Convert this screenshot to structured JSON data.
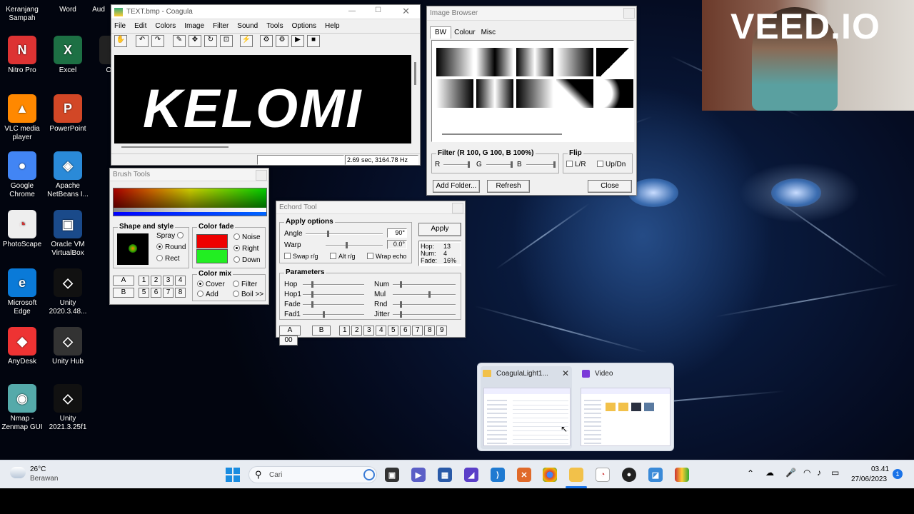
{
  "desktop_icons": [
    {
      "label": "Keranjang Sampah",
      "icon": "recycle-bin-icon"
    },
    {
      "label": "Word",
      "icon": "word-icon"
    },
    {
      "label": "Aud",
      "icon": "audacity-icon"
    },
    {
      "label": "Nitro Pro",
      "icon": "nitro-icon"
    },
    {
      "label": "Excel",
      "icon": "excel-icon"
    },
    {
      "label": "OBS",
      "icon": "obs-icon"
    },
    {
      "label": "VLC media player",
      "icon": "vlc-icon"
    },
    {
      "label": "PowerPoint",
      "icon": "powerpoint-icon"
    },
    {
      "label": "Google Chrome",
      "icon": "chrome-icon"
    },
    {
      "label": "Apache NetBeans I...",
      "icon": "netbeans-icon"
    },
    {
      "label": "PhotoScape",
      "icon": "photoscape-icon"
    },
    {
      "label": "Oracle VM VirtualBox",
      "icon": "virtualbox-icon"
    },
    {
      "label": "Microsoft Edge",
      "icon": "edge-icon"
    },
    {
      "label": "Unity 2020.3.48...",
      "icon": "unity-icon"
    },
    {
      "label": "AnyDesk",
      "icon": "anydesk-icon"
    },
    {
      "label": "Unity Hub",
      "icon": "unity-hub-icon"
    },
    {
      "label": "Nmap - Zenmap GUI",
      "icon": "nmap-icon"
    },
    {
      "label": "Unity 2021.3.25f1",
      "icon": "unity-icon"
    }
  ],
  "watermark": "VEED.IO",
  "coagula": {
    "title": "TEXT.bmp - Coagula",
    "menu": [
      "File",
      "Edit",
      "Colors",
      "Image",
      "Filter",
      "Sound",
      "Tools",
      "Options",
      "Help"
    ],
    "canvas_text": "KELOMI",
    "status": "2.69 sec, 3164.78 Hz"
  },
  "image_browser": {
    "title": "Image Browser",
    "tabs": [
      "BW",
      "Colour",
      "Misc"
    ],
    "filter_label": "Filter (R 100, G 100, B 100%)",
    "filter_channels": [
      "R",
      "G",
      "B"
    ],
    "flip_label": "Flip",
    "flip_lr": "L/R",
    "flip_ud": "Up/Dn",
    "add_folder": "Add Folder...",
    "refresh": "Refresh",
    "close": "Close"
  },
  "brush_tools": {
    "title": "Brush Tools",
    "shape_label": "Shape and style",
    "shape_options": [
      "Spray",
      "Round",
      "Rect"
    ],
    "shape_selected": "Round",
    "color_fade_label": "Color fade",
    "fade_options": [
      "Noise",
      "Right",
      "Down"
    ],
    "fade_selected": "Right",
    "color_mix_label": "Color mix",
    "mix_options": [
      "Cover",
      "Filter",
      "Add",
      "Boil >>"
    ],
    "mix_selected": "Cover",
    "presets_a": "A",
    "presets_b": "B",
    "numbers": [
      "1",
      "2",
      "3",
      "4",
      "5",
      "6",
      "7",
      "8"
    ]
  },
  "echord": {
    "title": "Echord Tool",
    "apply_options": "Apply options",
    "angle_label": "Angle",
    "angle_value": "90°",
    "warp_label": "Warp",
    "warp_value": "0.0°",
    "swap": "Swap r/g",
    "alt": "Alt r/g",
    "wrap": "Wrap echo",
    "apply": "Apply",
    "hop_text": "Hop:",
    "hop_val": "13",
    "num_text": "Num:",
    "num_val": "4",
    "fade_text": "Fade:",
    "fade_val": "16%",
    "parameters": "Parameters",
    "params_left": [
      "Hop",
      "Hop1",
      "Fade",
      "Fad1"
    ],
    "params_right": [
      "Num",
      "Mul",
      "Rnd",
      "Jitter"
    ],
    "preset_a": "A",
    "preset_b": "B",
    "numbers": [
      "1",
      "2",
      "3",
      "4",
      "5",
      "6",
      "7",
      "8",
      "9"
    ],
    "last": "00"
  },
  "task_preview": {
    "item1": "CoagulaLight1...",
    "item2": "Video"
  },
  "taskbar": {
    "weather_temp": "26°C",
    "weather_desc": "Berawan",
    "search_placeholder": "Cari",
    "time": "03.41",
    "date": "27/06/2023",
    "notification_count": "1"
  }
}
